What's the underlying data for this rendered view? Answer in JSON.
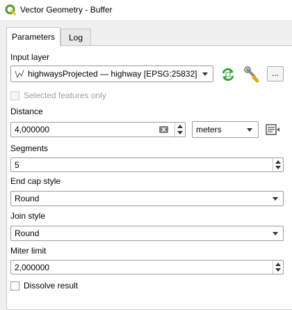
{
  "window": {
    "title": "Vector Geometry - Buffer",
    "logo_icon": "qgis-logo-icon"
  },
  "tabs": [
    {
      "label": "Parameters",
      "active": true
    },
    {
      "label": "Log",
      "active": false
    }
  ],
  "input_layer": {
    "label": "Input layer",
    "value": "highwaysProjected — highway [EPSG:25832]",
    "layer_icon": "line-layer-icon",
    "iterate_icon": "iterate-icon",
    "settings_icon": "wrench-icon",
    "more_label": "..."
  },
  "selected_only": {
    "label": "Selected features only",
    "checked": false,
    "enabled": false
  },
  "distance": {
    "label": "Distance",
    "value": "4,000000",
    "unit": "meters",
    "override_icon": "data-defined-override-icon"
  },
  "segments": {
    "label": "Segments",
    "value": "5"
  },
  "end_cap": {
    "label": "End cap style",
    "value": "Round"
  },
  "join_style": {
    "label": "Join style",
    "value": "Round"
  },
  "miter_limit": {
    "label": "Miter limit",
    "value": "2,000000"
  },
  "dissolve": {
    "label": "Dissolve result",
    "checked": false
  },
  "colors": {
    "qgis_green": "#589632",
    "qgis_yellow": "#f0c419",
    "iterate_green": "#3ca03c"
  }
}
